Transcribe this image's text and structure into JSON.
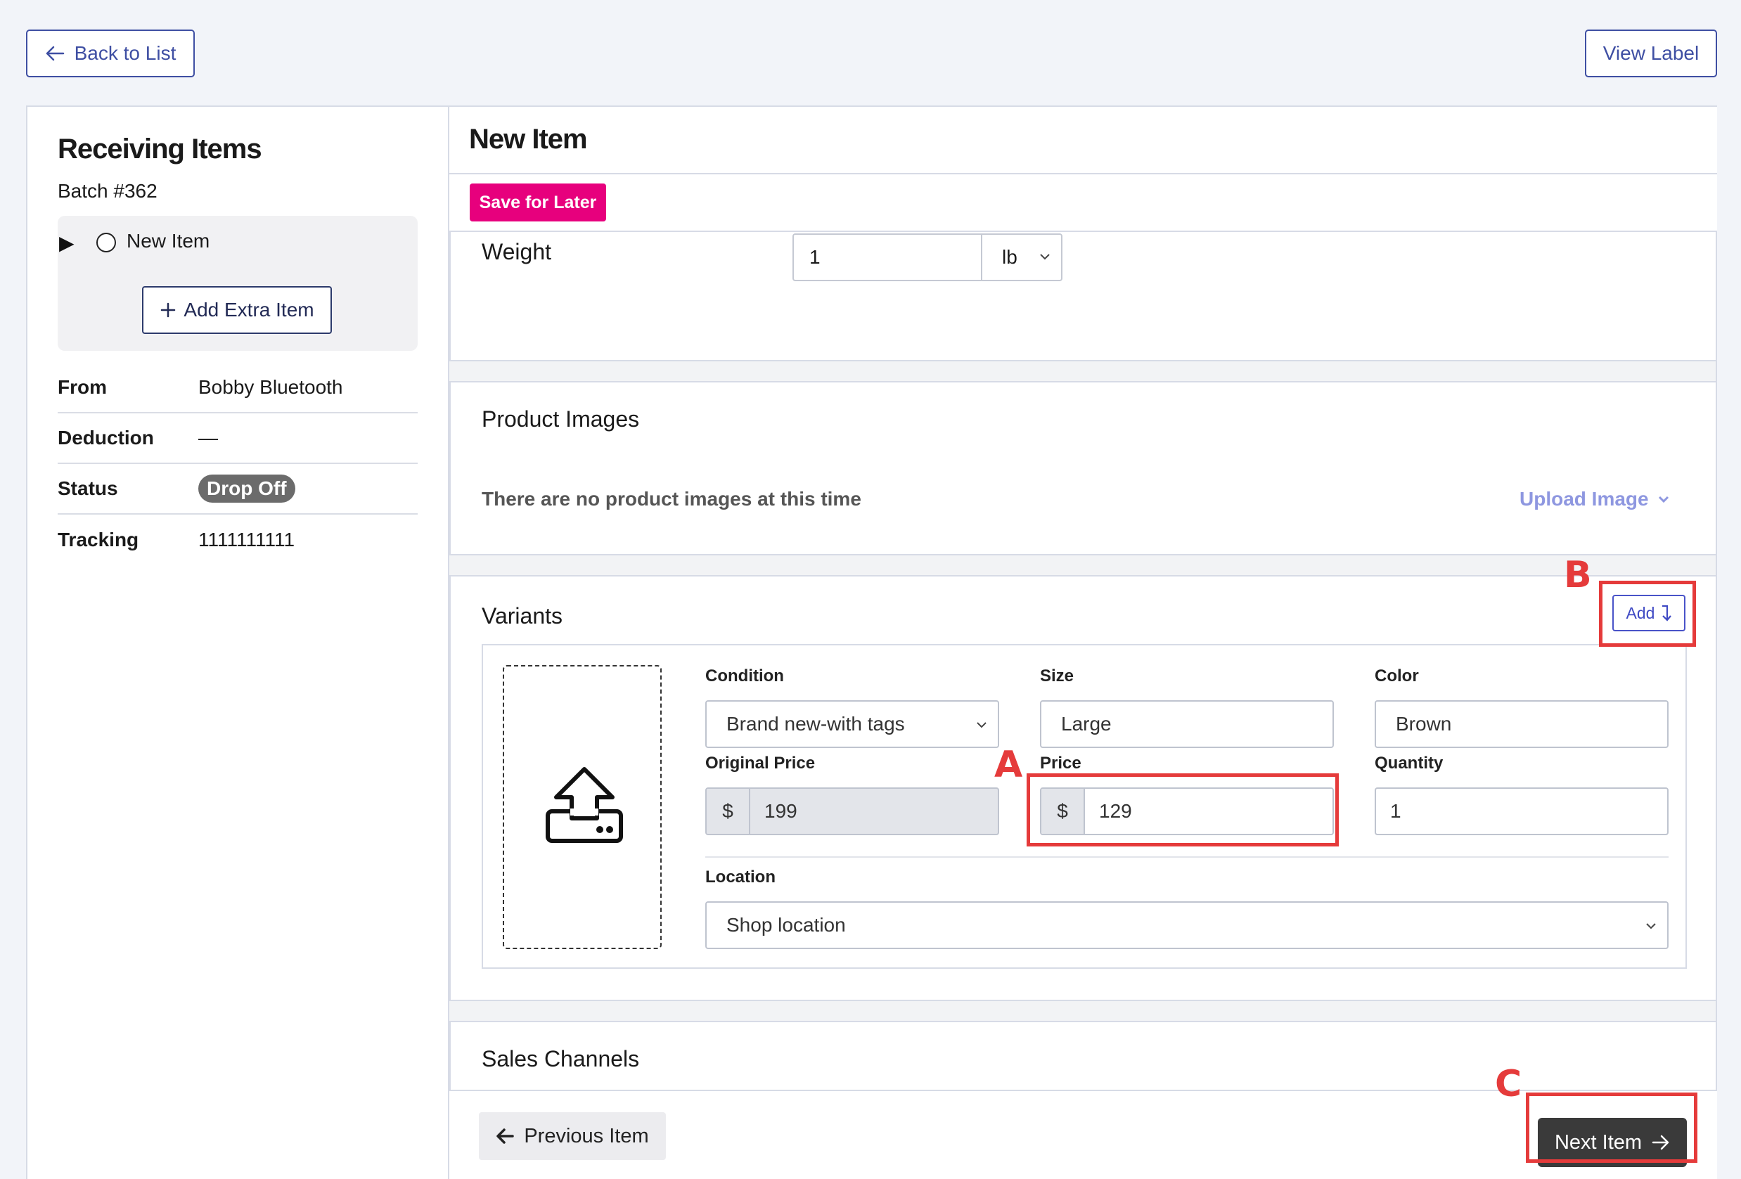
{
  "toolbar": {
    "back_label": "Back to List",
    "view_label": "View Label"
  },
  "sidebar": {
    "title": "Receiving Items",
    "batch": "Batch #362",
    "item_name": "New Item",
    "add_extra_label": "Add Extra Item",
    "info": [
      {
        "key": "From",
        "value": "Bobby Bluetooth"
      },
      {
        "key": "Deduction",
        "value": "—"
      },
      {
        "key": "Status",
        "value": "Drop Off"
      },
      {
        "key": "Tracking",
        "value": "1111111111"
      }
    ]
  },
  "main": {
    "title": "New Item",
    "save_later": "Save for Later",
    "weight": {
      "label": "Weight",
      "value": "1",
      "unit": "lb"
    },
    "images": {
      "title": "Product Images",
      "empty_text": "There are no product images at this time",
      "upload_label": "Upload Image"
    },
    "variants": {
      "title": "Variants",
      "add_label": "Add",
      "condition": {
        "label": "Condition",
        "value": "Brand new-with tags"
      },
      "size": {
        "label": "Size",
        "value": "Large"
      },
      "color": {
        "label": "Color",
        "value": "Brown"
      },
      "original_price": {
        "label": "Original Price",
        "currency": "$",
        "value": "199"
      },
      "price": {
        "label": "Price",
        "currency": "$",
        "value": "129"
      },
      "quantity": {
        "label": "Quantity",
        "value": "1"
      },
      "location": {
        "label": "Location",
        "value": "Shop location"
      }
    },
    "sales_channels": {
      "title": "Sales Channels"
    },
    "footer": {
      "prev_label": "Previous Item",
      "next_label": "Next Item"
    }
  },
  "annotations": {
    "a": "A",
    "b": "B",
    "c": "C",
    "color": "#e53b3b"
  },
  "colors": {
    "accent": "#3f4fa3",
    "save_button": "#e7007d",
    "next_button": "#3a3a3a",
    "link": "#8e97e0"
  }
}
